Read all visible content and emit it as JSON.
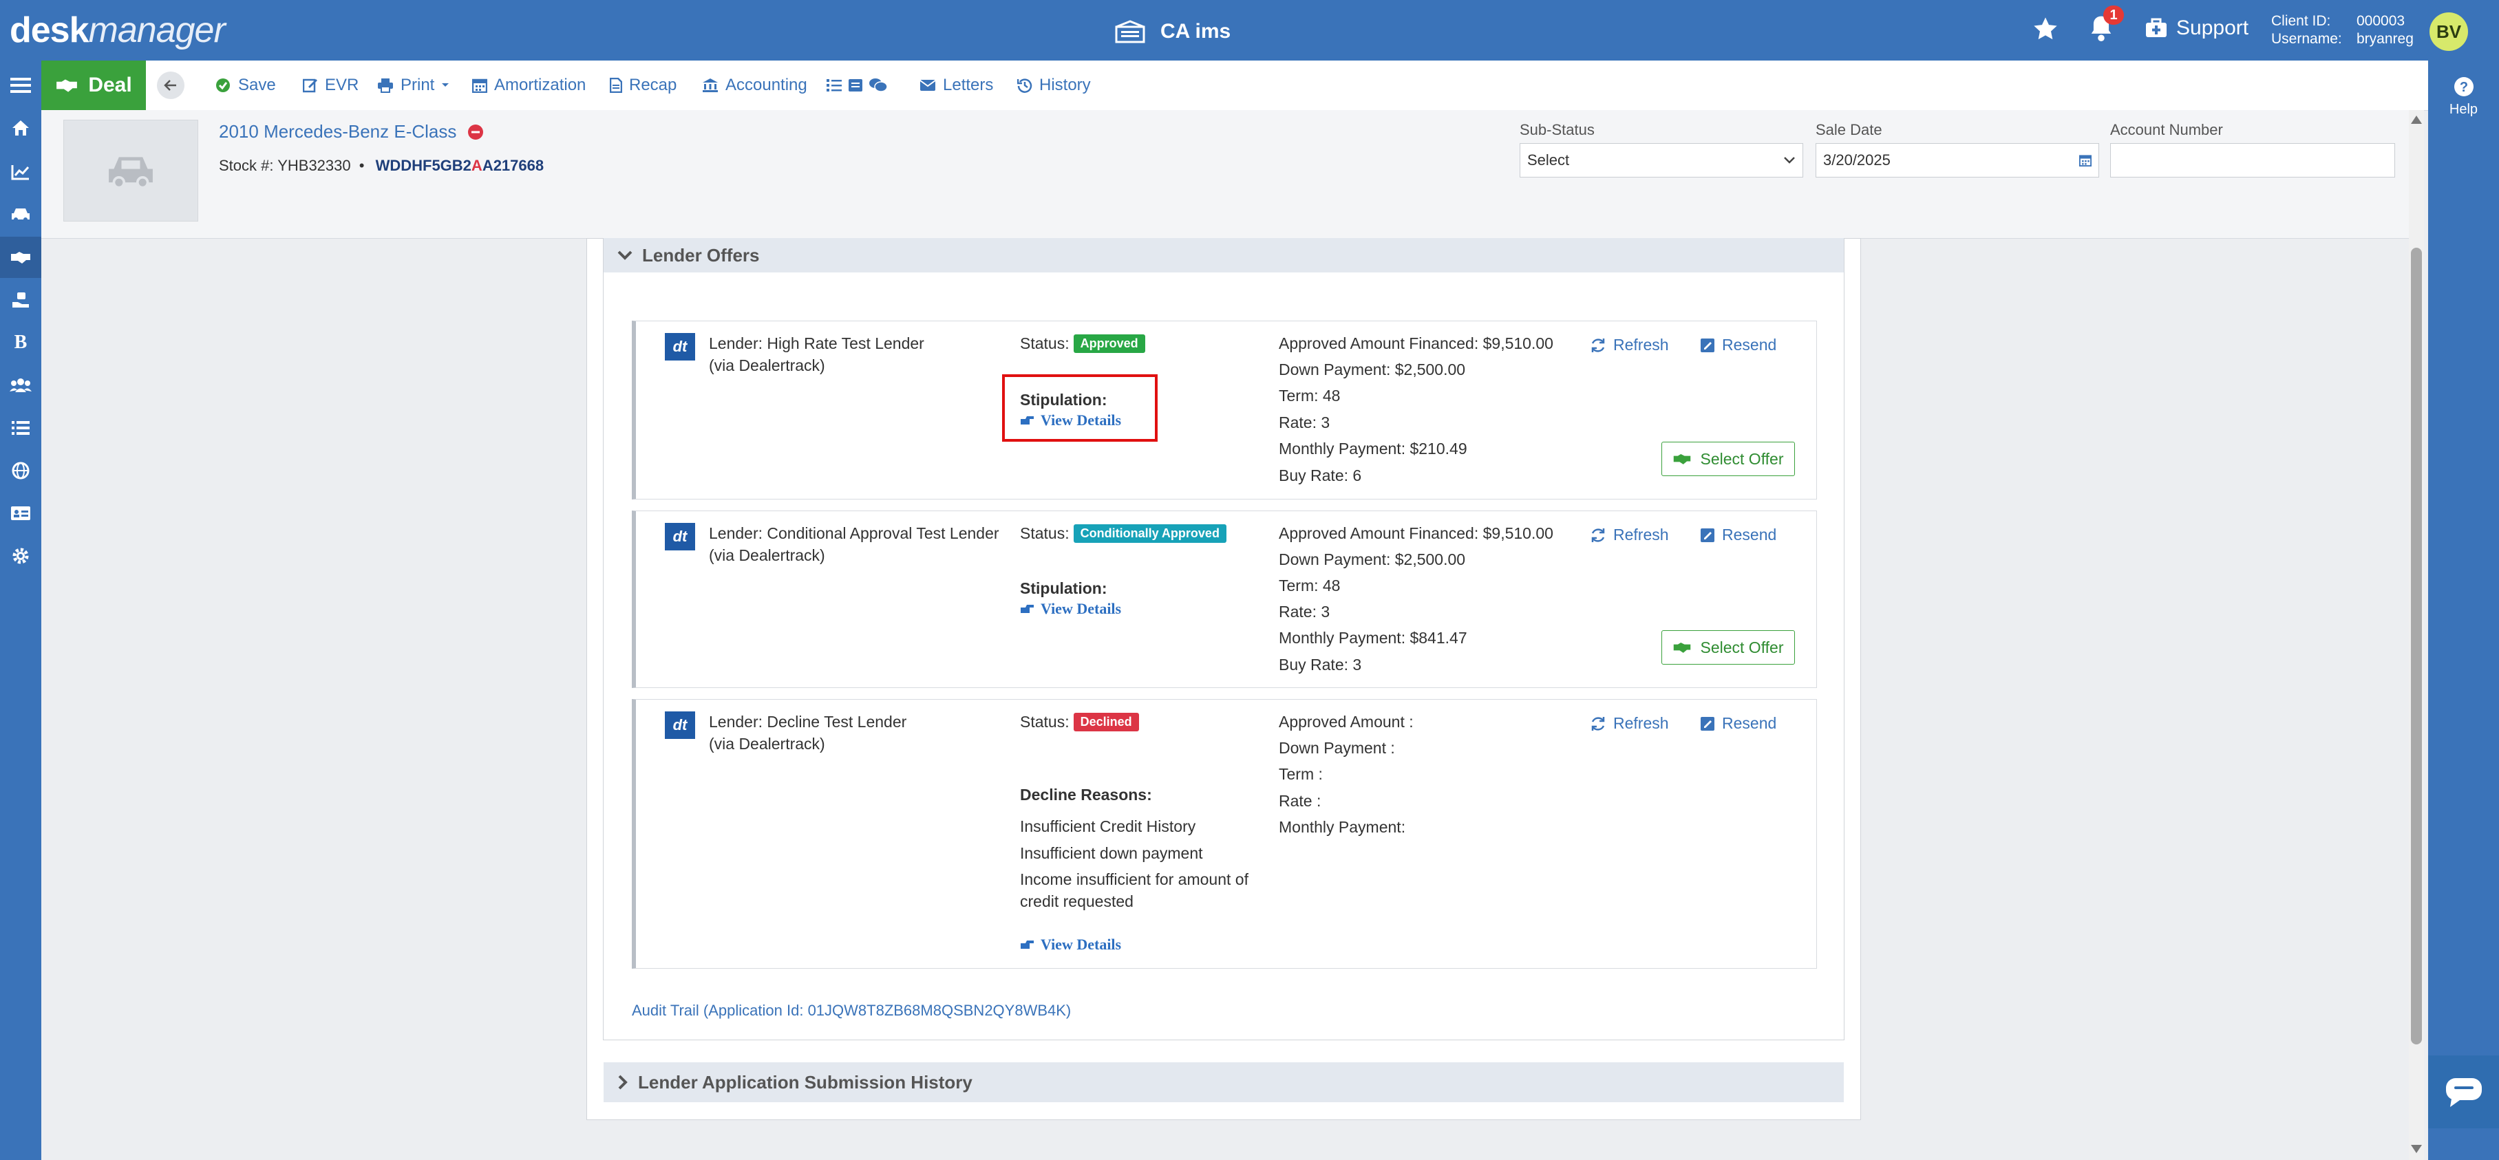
{
  "app": {
    "logo_bold": "desk",
    "logo_light": "manager",
    "company": "CA ims"
  },
  "header": {
    "notifications_count": "1",
    "support_label": "Support",
    "client_id_label": "Client ID:",
    "client_id": "000003",
    "username_label": "Username:",
    "username": "bryanreg",
    "avatar_initials": "BV",
    "help_label": "Help"
  },
  "sidebar": {
    "items": [
      "home-icon",
      "chart-icon",
      "car-icon",
      "handshake-icon",
      "hand-money-icon",
      "bold-b-icon",
      "users-icon",
      "list-icon",
      "globe-icon",
      "id-card-icon",
      "gear-icon"
    ],
    "active_index": 3
  },
  "toolbar": {
    "deal_label": "Deal",
    "save": "Save",
    "evr": "EVR",
    "print": "Print",
    "amortization": "Amortization",
    "recap": "Recap",
    "accounting": "Accounting",
    "letters": "Letters",
    "history": "History"
  },
  "vehicle": {
    "title": "2010 Mercedes-Benz E-Class",
    "stock_label": "Stock #:",
    "stock_number": "YHB32330",
    "separator": "•",
    "vin_part1": "WDDHF5GB2",
    "vin_part2": "A",
    "vin_part3": "A217668"
  },
  "fields": {
    "sub_status_label": "Sub-Status",
    "sub_status_value": "Select",
    "sale_date_label": "Sale Date",
    "sale_date_value": "3/20/2025",
    "account_number_label": "Account Number",
    "account_number_value": ""
  },
  "lender_offers": {
    "section_title": "Lender Offers",
    "status_label": "Status:",
    "refresh_label": "Refresh",
    "resend_label": "Resend",
    "select_offer_label": "Select Offer",
    "view_details_label": "View Details",
    "stipulation_label": "Stipulation:",
    "offers": [
      {
        "lender": "Lender: High Rate Test Lender",
        "via": "(via Dealertrack)",
        "status": "Approved",
        "approved_amount": "Approved Amount Financed: $9,510.00",
        "down_payment": "Down Payment: $2,500.00",
        "term": "Term: 48",
        "rate": "Rate: 3",
        "monthly_payment": "Monthly Payment: $210.49",
        "buy_rate": "Buy Rate: 6"
      },
      {
        "lender": "Lender: Conditional Approval Test Lender",
        "via": "(via Dealertrack)",
        "status": "Conditionally Approved",
        "approved_amount": "Approved Amount Financed: $9,510.00",
        "down_payment": "Down Payment: $2,500.00",
        "term": "Term: 48",
        "rate": "Rate: 3",
        "monthly_payment": "Monthly Payment: $841.47",
        "buy_rate": "Buy Rate: 3"
      },
      {
        "lender": "Lender: Decline Test Lender",
        "via": "(via Dealertrack)",
        "status": "Declined",
        "approved_amount": "Approved Amount :",
        "down_payment": "Down Payment :",
        "term": "Term :",
        "rate": "Rate :",
        "monthly_payment": "Monthly Payment:",
        "decline_reasons_label": "Decline Reasons:",
        "decline_reasons": [
          "Insufficient Credit History",
          "Insufficient down payment",
          "Income insufficient for amount of",
          "credit requested"
        ]
      }
    ],
    "audit_trail": "Audit Trail (Application Id: 01JQW8T8ZB68M8QSBN2QY8WB4K)"
  },
  "history_section": {
    "title": "Lender Application Submission History"
  },
  "colors": {
    "brand_blue": "#3a73b9",
    "deal_green": "#3aa13c",
    "approved": "#28a745",
    "conditional": "#17a2b8",
    "declined": "#dc3545",
    "highlight_red": "#e01010"
  }
}
